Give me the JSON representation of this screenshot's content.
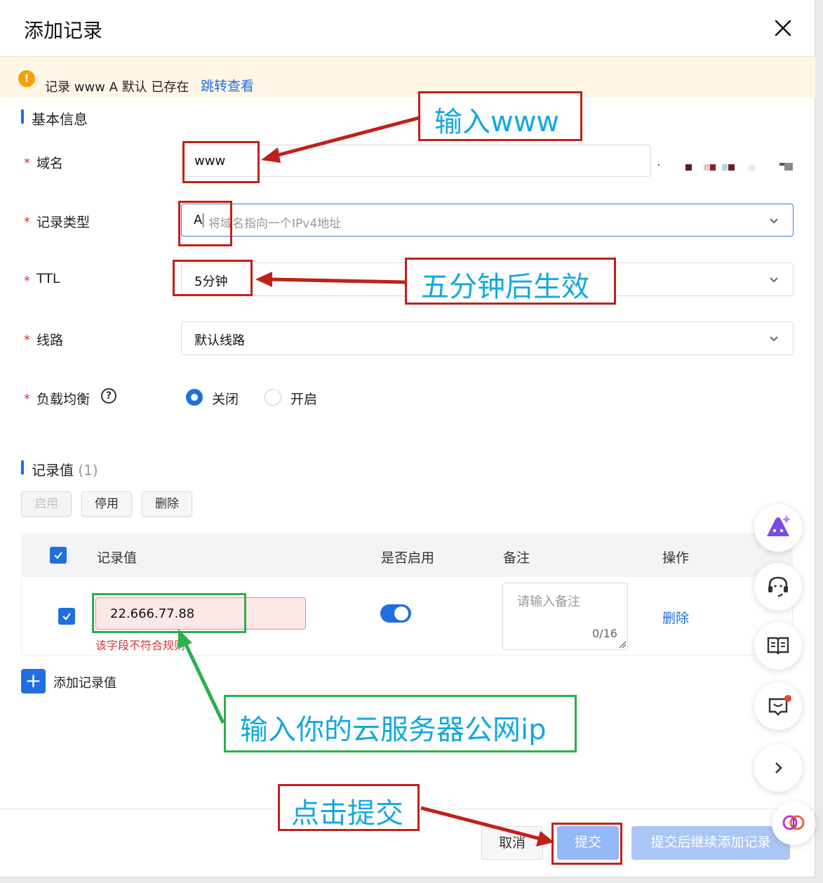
{
  "dialog": {
    "title": "添加记录"
  },
  "alert": {
    "text": "记录 www A 默认 已存在",
    "link": "跳转查看"
  },
  "basic": {
    "section": "基本信息",
    "domain": {
      "label": "域名",
      "value": "www",
      "suffix": "."
    },
    "type": {
      "label": "记录类型",
      "value": "A",
      "hint": "将域名指向一个IPv4地址"
    },
    "ttl": {
      "label": "TTL",
      "value": "5分钟"
    },
    "line": {
      "label": "线路",
      "value": "默认线路"
    },
    "lb": {
      "label": "负载均衡",
      "help": "?",
      "opt_off": "关闭",
      "opt_on": "开启",
      "selected": "关闭"
    }
  },
  "records": {
    "section": "记录值",
    "count": "(1)",
    "btn_enable": "启用",
    "btn_disable": "停用",
    "btn_delete": "删除",
    "columns": [
      "记录值",
      "是否启用",
      "备注",
      "操作"
    ],
    "row": {
      "value": "22.666.77.88",
      "error": "该字段不符合规则",
      "remark_placeholder": "请输入备注",
      "remark_counter": "0/16",
      "action": "删除",
      "enabled": true
    },
    "add_label": "添加记录值"
  },
  "footer": {
    "cancel": "取消",
    "submit": "提交",
    "submit_continue": "提交后继续添加记录"
  },
  "annotations": {
    "a1": "输入www",
    "a2": "五分钟后生效",
    "a3": "输入你的云服务器公网ip",
    "a4": "点击提交"
  },
  "colors": {
    "accent": "#1f6fe0",
    "annotation_red": "#c0211b",
    "annotation_green": "#2bb04a",
    "annotation_text": "#13a8de"
  },
  "icons": [
    "close-icon",
    "warning-icon",
    "chevron-down-icon",
    "help-icon",
    "check-icon",
    "plus-icon",
    "ai-assistant-icon",
    "headset-icon",
    "book-icon",
    "feedback-icon",
    "chevron-right-icon",
    "brain-icon"
  ]
}
